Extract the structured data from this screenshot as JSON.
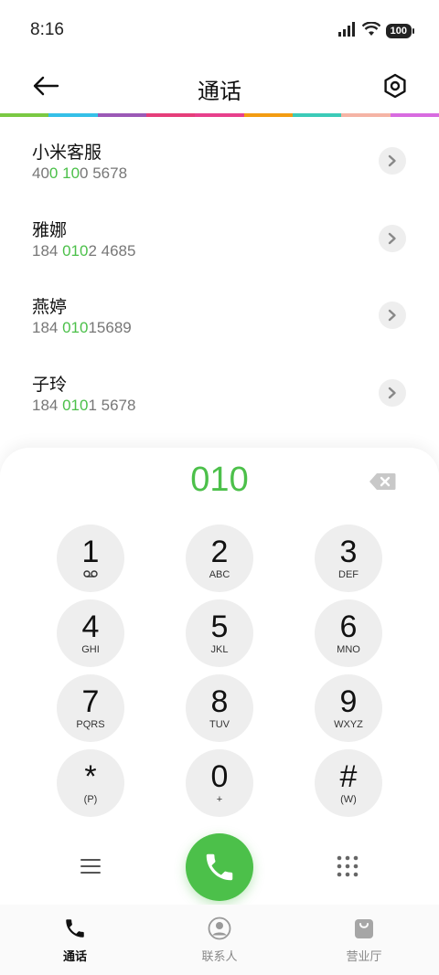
{
  "status_bar": {
    "time": "8:16",
    "battery": "100"
  },
  "header": {
    "title": "通话"
  },
  "color_strip": [
    "#7ac943",
    "#35c0e8",
    "#9b59b6",
    "#e63e7a",
    "#e8408c",
    "#f39c12",
    "#3ccbb8",
    "#f5b4a5",
    "#d86be0"
  ],
  "results": [
    {
      "name": "小米客服",
      "number_parts": [
        {
          "text": "40",
          "hl": false
        },
        {
          "text": "0",
          "hl": true
        },
        {
          "text": " ",
          "hl": false
        },
        {
          "text": "10",
          "hl": true
        },
        {
          "text": "0 5678",
          "hl": false
        }
      ]
    },
    {
      "name": "雅娜",
      "number_parts": [
        {
          "text": "184 ",
          "hl": false
        },
        {
          "text": "010",
          "hl": true
        },
        {
          "text": "2 4685",
          "hl": false
        }
      ]
    },
    {
      "name": "燕婷",
      "number_parts": [
        {
          "text": "184 ",
          "hl": false
        },
        {
          "text": "010",
          "hl": true
        },
        {
          "text": "15689",
          "hl": false
        }
      ]
    },
    {
      "name": "子玲",
      "number_parts": [
        {
          "text": "184 ",
          "hl": false
        },
        {
          "text": "010",
          "hl": true
        },
        {
          "text": "1 5678",
          "hl": false
        }
      ]
    }
  ],
  "dialer": {
    "display": "010",
    "keys": [
      {
        "digit": "1",
        "sub": "",
        "sub_icon": "voicemail-icon"
      },
      {
        "digit": "2",
        "sub": "ABC"
      },
      {
        "digit": "3",
        "sub": "DEF"
      },
      {
        "digit": "4",
        "sub": "GHI"
      },
      {
        "digit": "5",
        "sub": "JKL"
      },
      {
        "digit": "6",
        "sub": "MNO"
      },
      {
        "digit": "7",
        "sub": "PQRS"
      },
      {
        "digit": "8",
        "sub": "TUV"
      },
      {
        "digit": "9",
        "sub": "WXYZ"
      },
      {
        "digit": "*",
        "sub": "(P)"
      },
      {
        "digit": "0",
        "sub": "+"
      },
      {
        "digit": "#",
        "sub": "(W)"
      }
    ]
  },
  "tabs": [
    {
      "label": "通话",
      "icon": "phone-icon",
      "active": true
    },
    {
      "label": "联系人",
      "icon": "contact-icon",
      "active": false
    },
    {
      "label": "营业厅",
      "icon": "shopping-bag-icon",
      "active": false
    }
  ],
  "colors": {
    "accent": "#4cc04a",
    "key_bg": "#eeeeee"
  }
}
